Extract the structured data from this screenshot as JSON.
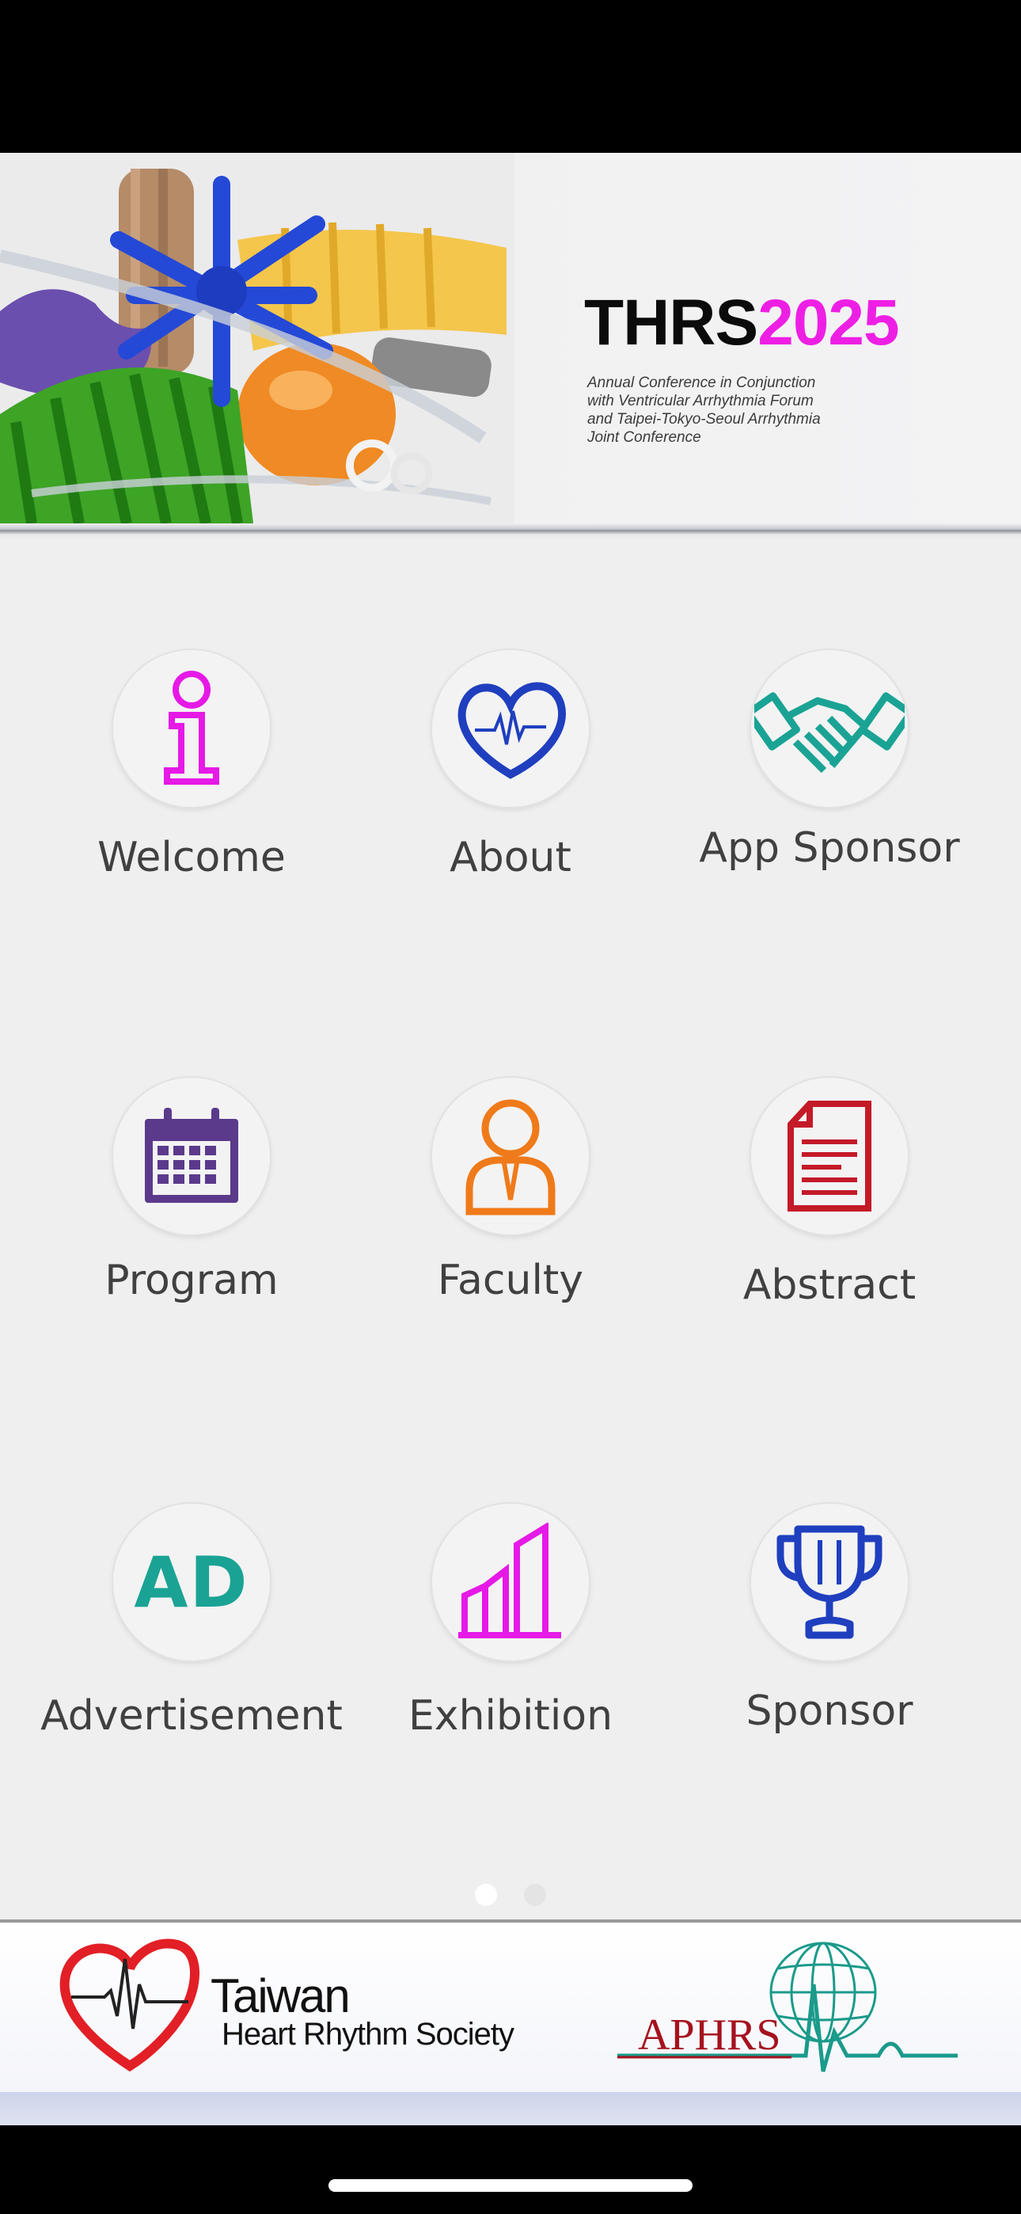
{
  "banner": {
    "title_part1": "THRS",
    "title_part2": "2025",
    "subtitle_lines": [
      "Annual Conference in Conjunction",
      "with Ventricular Arrhythmia Forum",
      "and Taipei-Tokyo-Seoul Arrhythmia",
      "Joint Conference"
    ]
  },
  "menu": {
    "items": [
      {
        "label": "Welcome",
        "icon": "info-icon",
        "color": "#e619e6"
      },
      {
        "label": "About",
        "icon": "heart-ecg-icon",
        "color": "#1f3fbf"
      },
      {
        "label": "App Sponsor",
        "icon": "handshake-icon",
        "color": "#1aa394"
      },
      {
        "label": "Program",
        "icon": "calendar-icon",
        "color": "#5b3a8c"
      },
      {
        "label": "Faculty",
        "icon": "person-icon",
        "color": "#ef7a1a"
      },
      {
        "label": "Abstract",
        "icon": "document-icon",
        "color": "#c41a28"
      },
      {
        "label": "Advertisement",
        "icon_text": "AD",
        "icon": "ad-icon",
        "color": "#1aa394"
      },
      {
        "label": "Exhibition",
        "icon": "bar-chart-icon",
        "color": "#e619e6"
      },
      {
        "label": "Sponsor",
        "icon": "trophy-icon",
        "color": "#1f3fbf"
      }
    ]
  },
  "pager": {
    "current_page": 1,
    "total_pages": 2
  },
  "footer": {
    "ths_name": "Taiwan",
    "ths_subname": "Heart Rhythm Society",
    "aphrs_name": "APHRS"
  }
}
